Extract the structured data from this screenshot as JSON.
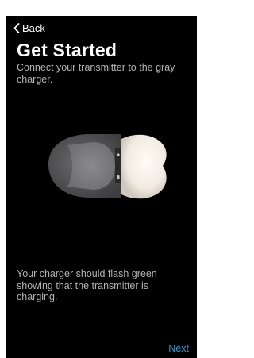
{
  "nav": {
    "back_label": "Back",
    "back_icon": "chevron-left-icon"
  },
  "header": {
    "title": "Get Started",
    "subtitle": "Connect your transmitter to the gray charger."
  },
  "illustration": {
    "description_icon": "transmitter-on-charger-icon",
    "charger_color": "#5a5a5c",
    "transmitter_color": "#f2ece3"
  },
  "body": {
    "note": "Your charger should flash green showing that the transmitter is charging."
  },
  "footer": {
    "next_label": "Next",
    "accent": "#2a9fe0"
  }
}
